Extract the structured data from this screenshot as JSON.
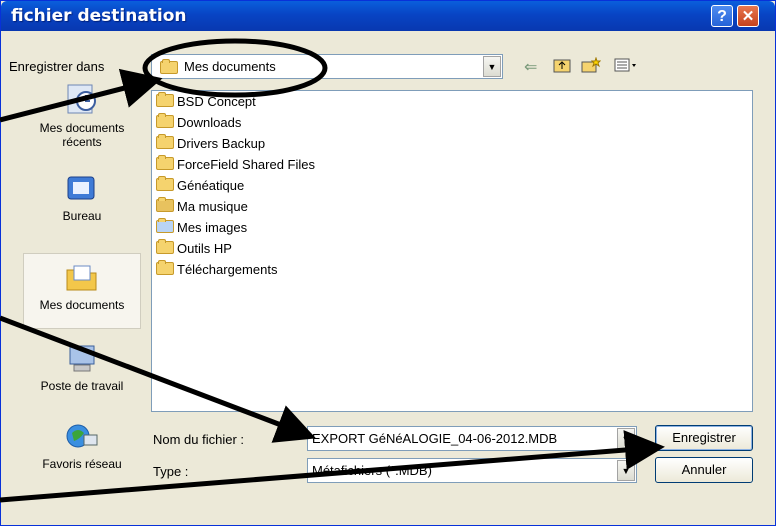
{
  "window": {
    "title": "fichier destination",
    "help_label": "?",
    "close_label": "✕"
  },
  "save_in": {
    "label": "Enregistrer dans",
    "value": "Mes documents"
  },
  "toolbar": {
    "back_icon": "back-arrow-icon",
    "up_icon": "up-folder-icon",
    "new_folder_icon": "new-folder-icon",
    "view_icon": "view-menu-icon"
  },
  "places": [
    {
      "label": "Mes documents\nrécents",
      "icon": "recent-documents-icon"
    },
    {
      "label": "Bureau",
      "icon": "desktop-icon"
    },
    {
      "label": "Mes documents",
      "icon": "my-documents-icon"
    },
    {
      "label": "Poste de travail",
      "icon": "my-computer-icon"
    },
    {
      "label": "Favoris réseau",
      "icon": "network-places-icon"
    }
  ],
  "files": [
    {
      "name": "BSD Concept",
      "icon": "folder-icon"
    },
    {
      "name": "Downloads",
      "icon": "folder-icon"
    },
    {
      "name": "Drivers Backup",
      "icon": "folder-icon"
    },
    {
      "name": "ForceField Shared Files",
      "icon": "folder-icon"
    },
    {
      "name": "Généatique",
      "icon": "folder-icon"
    },
    {
      "name": "Ma musique",
      "icon": "music-folder-icon"
    },
    {
      "name": "Mes images",
      "icon": "pictures-folder-icon"
    },
    {
      "name": "Outils HP",
      "icon": "folder-icon"
    },
    {
      "name": "Téléchargements",
      "icon": "folder-icon"
    }
  ],
  "filename": {
    "label": "Nom du fichier :",
    "value": "EXPORT GéNéALOGIE_04-06-2012.MDB"
  },
  "filetype": {
    "label": "Type :",
    "value": "Métafichiers (*.MDB)"
  },
  "buttons": {
    "save": "Enregistrer",
    "cancel": "Annuler"
  }
}
